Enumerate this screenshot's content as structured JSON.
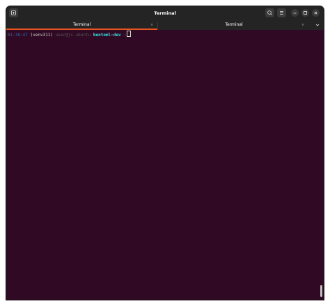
{
  "window": {
    "title": "Terminal"
  },
  "titlebar": {
    "new_tab_icon": "new-tab-icon",
    "search_icon": "search-icon",
    "menu_icon": "hamburger-menu-icon",
    "minimize_icon": "minimize-icon",
    "maximize_icon": "maximize-icon",
    "close_icon": "close-icon"
  },
  "tabs": [
    {
      "label": "Terminal",
      "active": true,
      "close": "×"
    },
    {
      "label": "Terminal",
      "active": false,
      "close": "×"
    }
  ],
  "tab_menu_icon": "chevron-down-icon",
  "terminal": {
    "prompt": {
      "time": "01:38:47",
      "venv": "(venv311)",
      "user_host": "user@js-ubuntu",
      "directory": "bentoml-dev",
      "arrow": "~"
    }
  },
  "colors": {
    "terminal_bg": "#300a24",
    "header_bg": "#242424",
    "accent": "#e95420"
  }
}
